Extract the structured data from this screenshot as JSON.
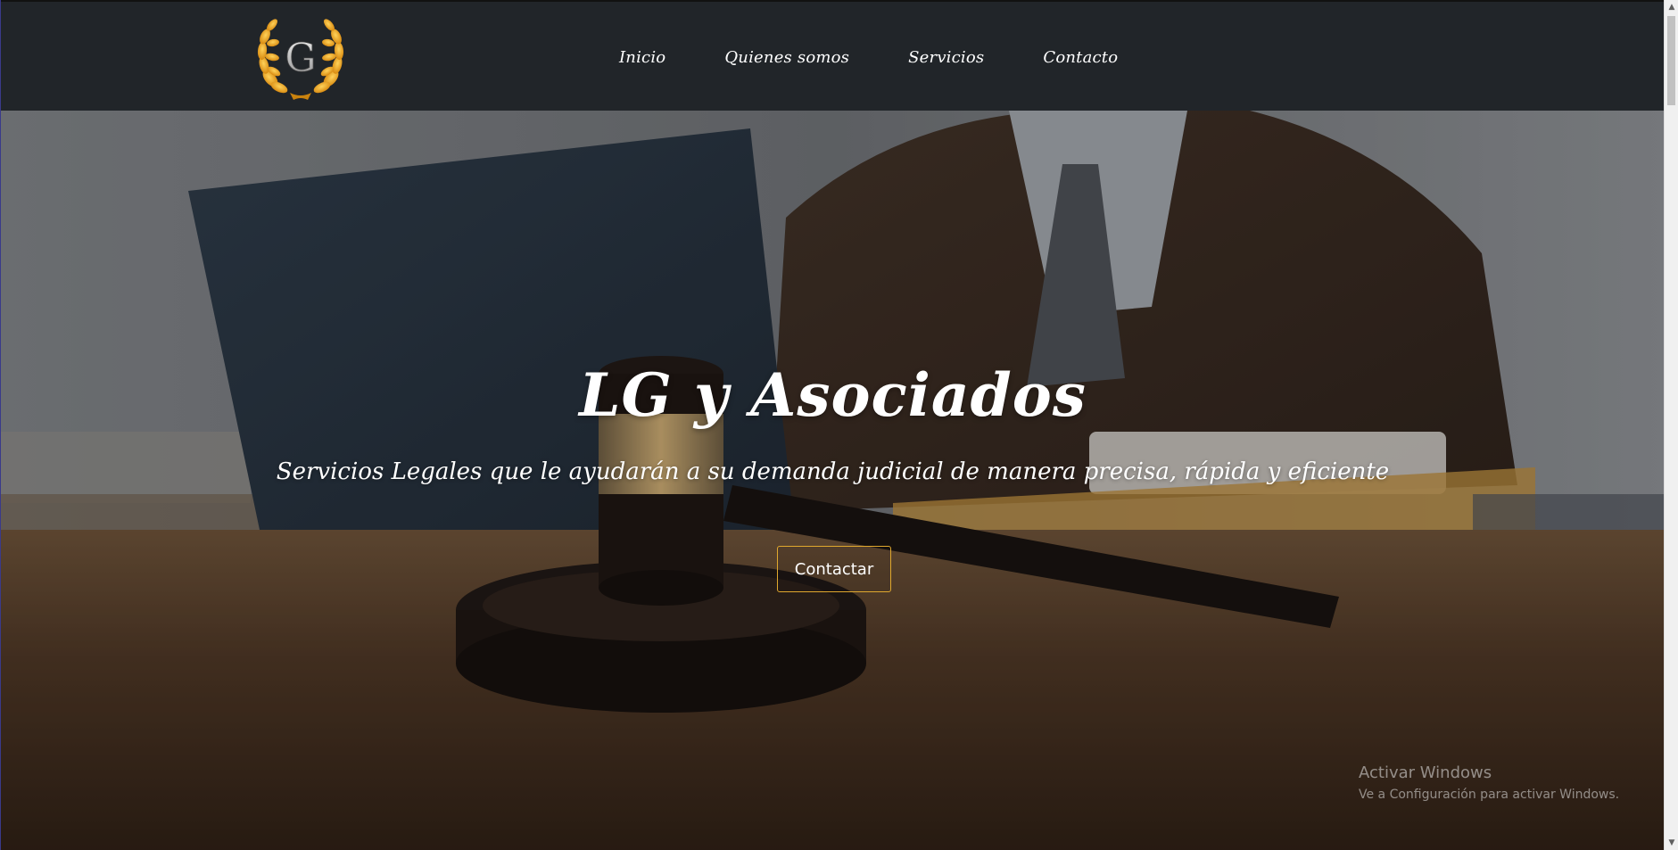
{
  "brand": {
    "logo_letter": "G",
    "accent_color": "#e6a21c"
  },
  "nav": {
    "items": [
      {
        "label": "Inicio"
      },
      {
        "label": "Quienes somos"
      },
      {
        "label": "Servicios"
      },
      {
        "label": "Contacto"
      }
    ]
  },
  "hero": {
    "title": "LG y Asociados",
    "subtitle": "Servicios Legales que le ayudarán a su demanda judicial de manera precisa, rápida y eficiente",
    "button_label": "Contactar",
    "button_border_color": "#e0a82e"
  },
  "watermark": {
    "title": "Activar Windows",
    "subtitle": "Ve a Configuración para activar Windows."
  },
  "icons": [
    "laurel-logo-icon",
    "scroll-up-arrow-icon",
    "scroll-down-arrow-icon"
  ]
}
